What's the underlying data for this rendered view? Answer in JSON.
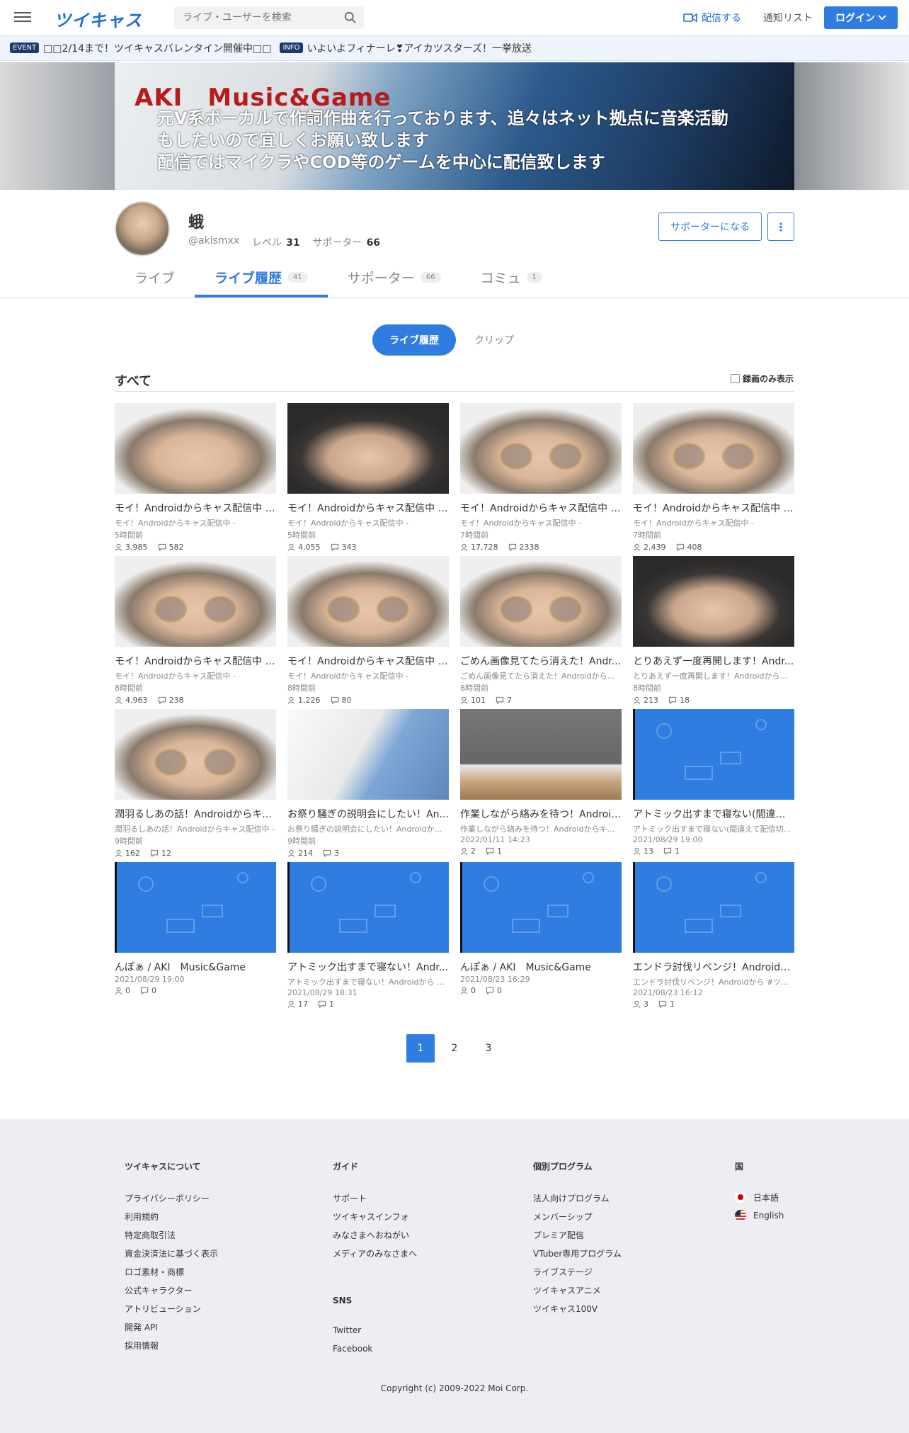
{
  "header": {
    "logo": "ツイキャス",
    "search_placeholder": "ライブ・ユーザーを検索",
    "broadcast_label": "配信する",
    "notice_label": "通知リスト",
    "login_label": "ログイン"
  },
  "ticker": {
    "event_badge": "EVENT",
    "event_text": "□□2/14まで！ツイキャスバレンタイン開催中□□",
    "info_badge": "INFO",
    "info_text": "いよいよフィナーレ❣アイカツスターズ！一挙放送"
  },
  "banner": {
    "title": "AKI　Music&Game",
    "text": "元V系ボーカルで作詞作曲を行っております、追々はネット拠点に音楽活動\nもしたいので宜しくお願い致します\n配信ではマイクラやCOD等のゲームを中心に配信致します"
  },
  "profile": {
    "name": "蛾",
    "handle": "@akismxx",
    "level_label": "レベル",
    "level": "31",
    "supporter_label": "サポーター",
    "supporters": "66",
    "become_supporter": "サポーターになる",
    "more": "⋮"
  },
  "tabs": [
    {
      "label": "ライブ",
      "count": ""
    },
    {
      "label": "ライブ履歴",
      "count": "41"
    },
    {
      "label": "サポーター",
      "count": "66"
    },
    {
      "label": "コミュ",
      "count": "1"
    }
  ],
  "segment": {
    "history": "ライブ履歴",
    "clip": "クリップ"
  },
  "section": {
    "title": "すべて",
    "recorded_only": "録画のみ表示"
  },
  "cards": [
    {
      "title": "モイ！Androidからキャス配信中 -...",
      "sub": "モイ！Androidからキャス配信中 -",
      "time": "5時間前",
      "viewers": "3,985",
      "comments": "582"
    },
    {
      "title": "モイ！Androidからキャス配信中 -...",
      "sub": "モイ！Androidからキャス配信中 -",
      "time": "5時間前",
      "viewers": "4,055",
      "comments": "343"
    },
    {
      "title": "モイ！Androidからキャス配信中 -...",
      "sub": "モイ！Androidからキャス配信中 -",
      "time": "7時間前",
      "viewers": "17,728",
      "comments": "2338"
    },
    {
      "title": "モイ！Androidからキャス配信中 -...",
      "sub": "モイ！Androidからキャス配信中 -",
      "time": "7時間前",
      "viewers": "2,439",
      "comments": "408"
    },
    {
      "title": "モイ！Androidからキャス配信中 -...",
      "sub": "モイ！Androidからキャス配信中 -",
      "time": "8時間前",
      "viewers": "4,963",
      "comments": "238"
    },
    {
      "title": "モイ！Androidからキャス配信中 -...",
      "sub": "モイ！Androidからキャス配信中 -",
      "time": "8時間前",
      "viewers": "1,226",
      "comments": "80"
    },
    {
      "title": "ごめん画像見てたら消えた！Andr...",
      "sub": "ごめん画像見てたら消えた！Androidからキ...",
      "time": "8時間前",
      "viewers": "101",
      "comments": "7"
    },
    {
      "title": "とりあえず一度再開します！Andr...",
      "sub": "とりあえず一度再開します！Androidからキ...",
      "time": "8時間前",
      "viewers": "213",
      "comments": "18"
    },
    {
      "title": "潤羽るしあの話！Androidからキャ...",
      "sub": "潤羽るしあの話！Androidからキャス配信中 -",
      "time": "9時間前",
      "viewers": "162",
      "comments": "12"
    },
    {
      "title": "お祭り騒ぎの説明会にしたい！An...",
      "sub": "お祭り騒ぎの説明会にしたい！Androidから...",
      "time": "9時間前",
      "viewers": "214",
      "comments": "3"
    },
    {
      "title": "作業しながら絡みを待つ！Android...",
      "sub": "作業しながら絡みを待つ！Androidからキャ...",
      "time": "2022/01/11 14:23",
      "viewers": "2",
      "comments": "1"
    },
    {
      "title": "アトミック出すまで寝ない(間違え...",
      "sub": "アトミック出すまで寝ない(間違えて配信切...",
      "time": "2021/08/29 19:00",
      "viewers": "13",
      "comments": "1"
    },
    {
      "title": "んぽぁ / AKI　Music&Game",
      "sub": "",
      "time": "2021/08/29 19:00",
      "viewers": "0",
      "comments": "0"
    },
    {
      "title": "アトミック出すまで寝ない！Andr...",
      "sub": "アトミック出すまで寝ない！Androidから #...",
      "time": "2021/08/29 18:31",
      "viewers": "17",
      "comments": "1"
    },
    {
      "title": "んぽぁ / AKI　Music&Game",
      "sub": "",
      "time": "2021/08/23 16:29",
      "viewers": "0",
      "comments": "0"
    },
    {
      "title": "エンドラ討伐リベンジ！Androidか...",
      "sub": "エンドラ討伐リベンジ！Androidから #ツイ...",
      "time": "2021/08/23 16:12",
      "viewers": "3",
      "comments": "1"
    }
  ],
  "pager": [
    "1",
    "2",
    "3"
  ],
  "footer": {
    "col1": {
      "head": "ツイキャスについて",
      "items": [
        "プライバシーポリシー",
        "利用規約",
        "特定商取引法",
        "資金決済法に基づく表示",
        "ロゴ素材・商標",
        "公式キャラクター",
        "アトリビューション",
        "開発 API",
        "採用情報"
      ]
    },
    "col2": {
      "head": "ガイド",
      "items": [
        "サポート",
        "ツイキャスインフォ",
        "みなさまへおねがい",
        "メディアのみなさまへ"
      ]
    },
    "col2b": {
      "head": "SNS",
      "items": [
        "Twitter",
        "Facebook"
      ]
    },
    "col3": {
      "head": "個別プログラム",
      "items": [
        "法人向けプログラム",
        "メンバーシップ",
        "プレミア配信",
        "VTuber専用プログラム",
        "ライブステージ",
        "ツイキャスアニメ",
        "ツイキャス100V"
      ]
    },
    "col4": {
      "head": "国",
      "items": [
        "日本語",
        "English"
      ]
    },
    "copyright": "Copyright (c) 2009-2022 Moi Corp."
  },
  "colors": {
    "accent": "#2f7de1",
    "logo": "#1c6fd6",
    "banner_title": "#b61c1c"
  }
}
